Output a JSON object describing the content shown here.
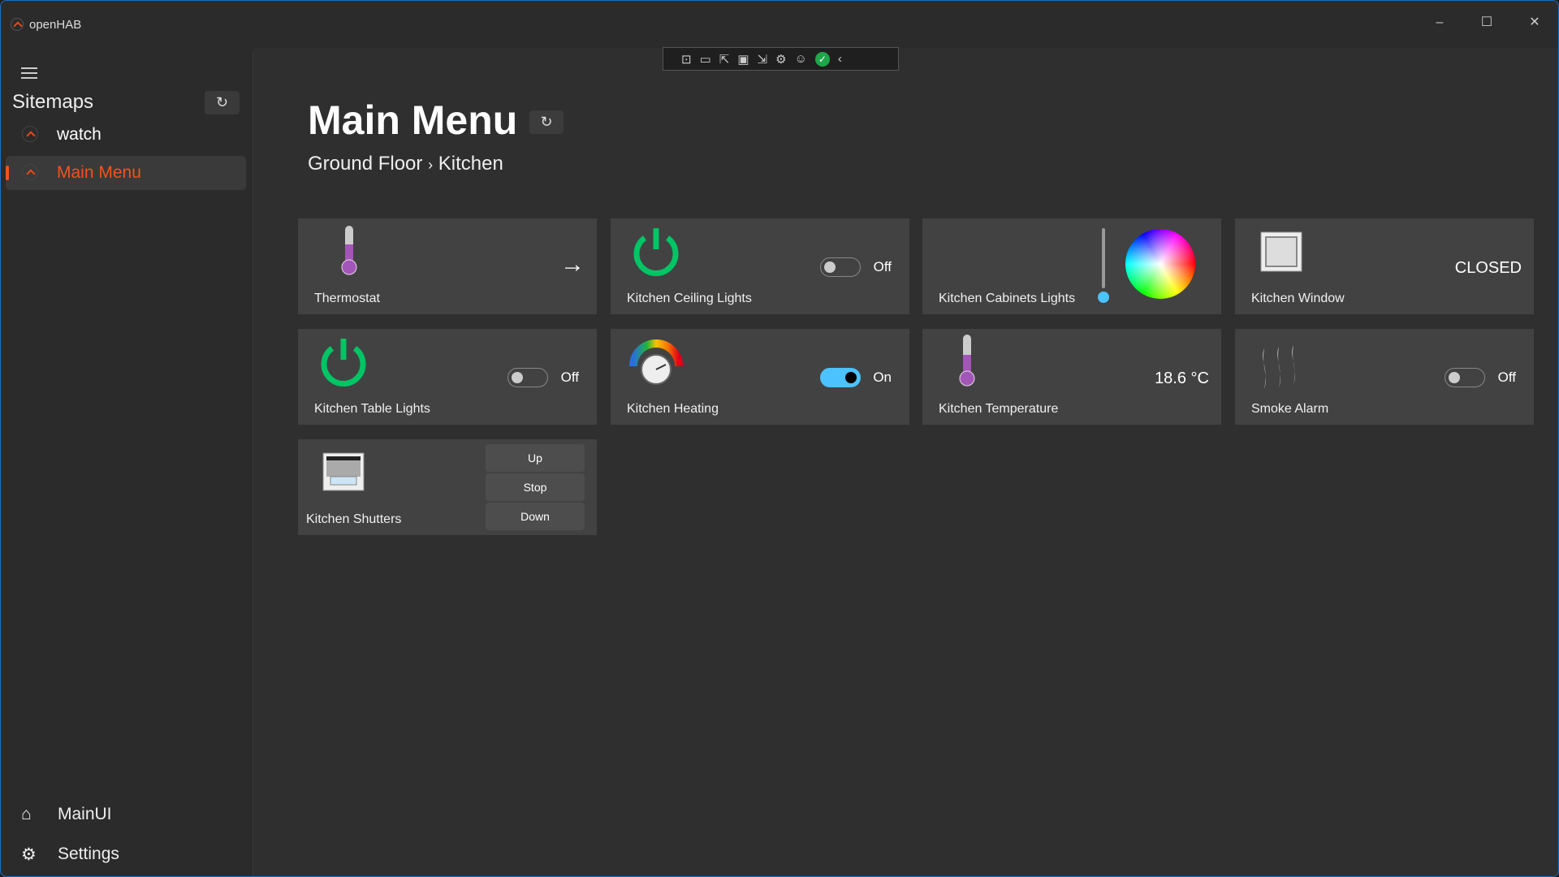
{
  "window": {
    "title": "openHAB",
    "minimize": "–",
    "maximize": "☐",
    "close": "✕"
  },
  "sidebar": {
    "heading": "Sitemaps",
    "refresh": "↻",
    "items": [
      {
        "label": "watch"
      },
      {
        "label": "Main Menu"
      }
    ],
    "bottom": [
      {
        "label": "MainUI",
        "icon": "⌂"
      },
      {
        "label": "Settings",
        "icon": "⚙"
      }
    ]
  },
  "toolbar": {
    "icons": [
      "⊡",
      "▭",
      "⇱",
      "▣",
      "⇲",
      "⚙",
      "☺",
      "✓",
      "‹"
    ]
  },
  "page": {
    "title": "Main Menu",
    "refresh": "↻",
    "breadcrumb": [
      "Ground Floor",
      "›",
      "Kitchen"
    ]
  },
  "cards": [
    {
      "name": "Thermostat",
      "arrow": "→"
    },
    {
      "name": "Kitchen Ceiling Lights",
      "state": "Off"
    },
    {
      "name": "Kitchen Cabinets Lights"
    },
    {
      "name": "Kitchen Window",
      "value": "CLOSED"
    },
    {
      "name": "Kitchen Table Lights",
      "state": "Off"
    },
    {
      "name": "Kitchen Heating",
      "state": "On"
    },
    {
      "name": "Kitchen Temperature",
      "value": "18.6 °C"
    },
    {
      "name": "Smoke Alarm",
      "state": "Off"
    },
    {
      "name": "Kitchen Shutters",
      "buttons": [
        "Up",
        "Stop",
        "Down"
      ]
    }
  ],
  "colors": {
    "accent": "#f4511e",
    "toggle_on": "#4cc2ff",
    "power_green": "#00c565",
    "thermo_purple": "#a355b8"
  }
}
